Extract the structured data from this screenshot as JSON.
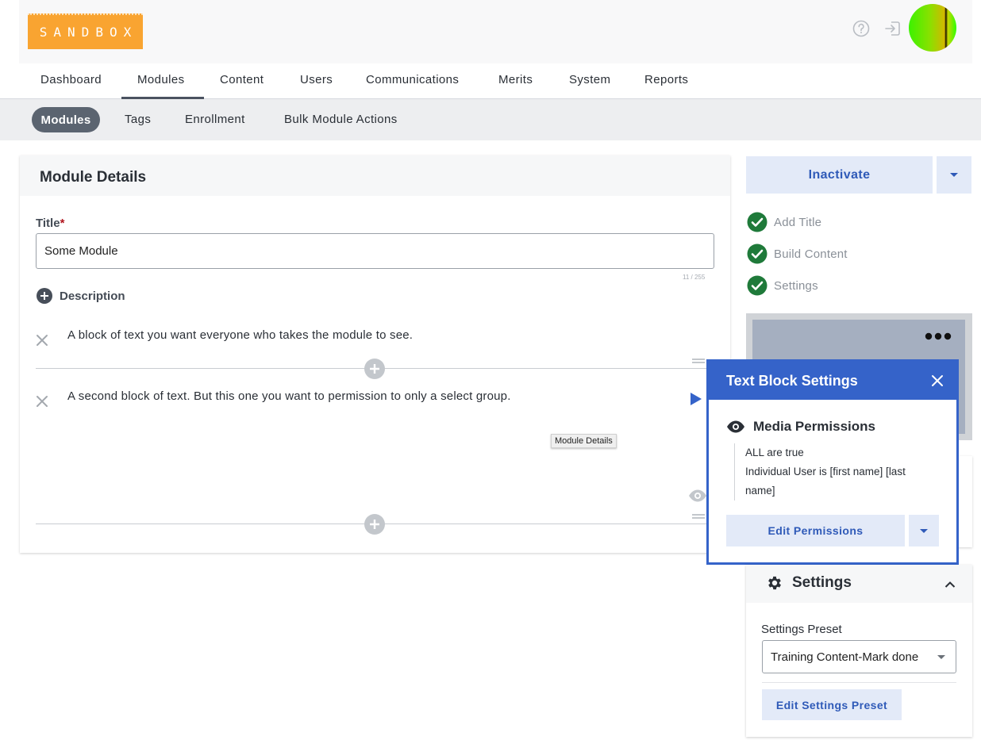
{
  "brand": {
    "logo_text": "SANDBOX"
  },
  "main_nav": {
    "items": [
      {
        "label": "Dashboard"
      },
      {
        "label": "Modules"
      },
      {
        "label": "Content"
      },
      {
        "label": "Users"
      },
      {
        "label": "Communications"
      },
      {
        "label": "Merits"
      },
      {
        "label": "System"
      },
      {
        "label": "Reports"
      }
    ],
    "active": "Modules"
  },
  "sub_nav": {
    "items": [
      {
        "label": "Modules"
      },
      {
        "label": "Tags"
      },
      {
        "label": "Enrollment"
      },
      {
        "label": "Bulk Module Actions"
      }
    ],
    "active": "Modules"
  },
  "module_details": {
    "heading": "Module Details",
    "title_label": "Title",
    "required_marker": "*",
    "title_value": "Some Module",
    "char_count": "11 / 255",
    "description_label": "Description",
    "blocks": [
      {
        "text": "A block of text you want everyone who takes the module to see."
      },
      {
        "text": "A second block of text. But this one you want to permission to only a select group."
      }
    ],
    "tooltip": "Module Details"
  },
  "actions": {
    "inactivate_label": "Inactivate",
    "steps": [
      {
        "label": "Add Title",
        "done": true
      },
      {
        "label": "Build Content",
        "done": true
      },
      {
        "label": "Settings",
        "done": true
      }
    ]
  },
  "text_block_settings": {
    "title": "Text Block Settings",
    "permissions_heading": "Media Permissions",
    "rules": [
      "ALL are true",
      "Individual User is [first name] [last name]"
    ],
    "edit_button": "Edit Permissions"
  },
  "settings": {
    "heading": "Settings",
    "preset_label": "Settings Preset",
    "preset_value": "Training Content-Mark done",
    "edit_button": "Edit Settings Preset"
  },
  "colors": {
    "accent": "#3563c9",
    "button_bg": "#e3eaf8",
    "success": "#1f7a3a",
    "logo": "#f9a431"
  }
}
